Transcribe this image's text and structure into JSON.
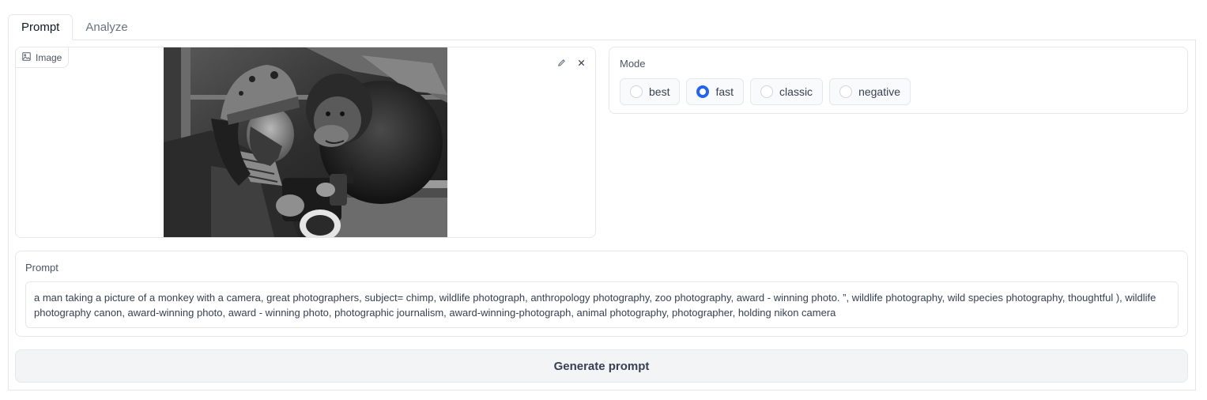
{
  "tabs": [
    {
      "label": "Prompt",
      "active": true
    },
    {
      "label": "Analyze",
      "active": false
    }
  ],
  "image_panel": {
    "label": "Image",
    "label_icon": "image-icon",
    "actions": [
      "edit-icon",
      "close-icon"
    ]
  },
  "mode": {
    "label": "Mode",
    "options": [
      "best",
      "fast",
      "classic",
      "negative"
    ],
    "selected": "fast"
  },
  "prompt": {
    "label": "Prompt",
    "value": "a man taking a picture of a monkey with a camera, great photographers, subject= chimp, wildlife photograph, anthropology photography, zoo photography, award - winning photo. ”, wildlife photography, wild species photography, thoughtful ), wildlife photography canon, award-winning photo, award - winning photo, photographic journalism, award-winning-photograph, animal photography, photographer, holding nikon camera"
  },
  "generate_button": {
    "label": "Generate prompt"
  },
  "colors": {
    "accent": "#2563eb",
    "border": "#e5e7eb",
    "button_bg": "#f3f4f6"
  }
}
